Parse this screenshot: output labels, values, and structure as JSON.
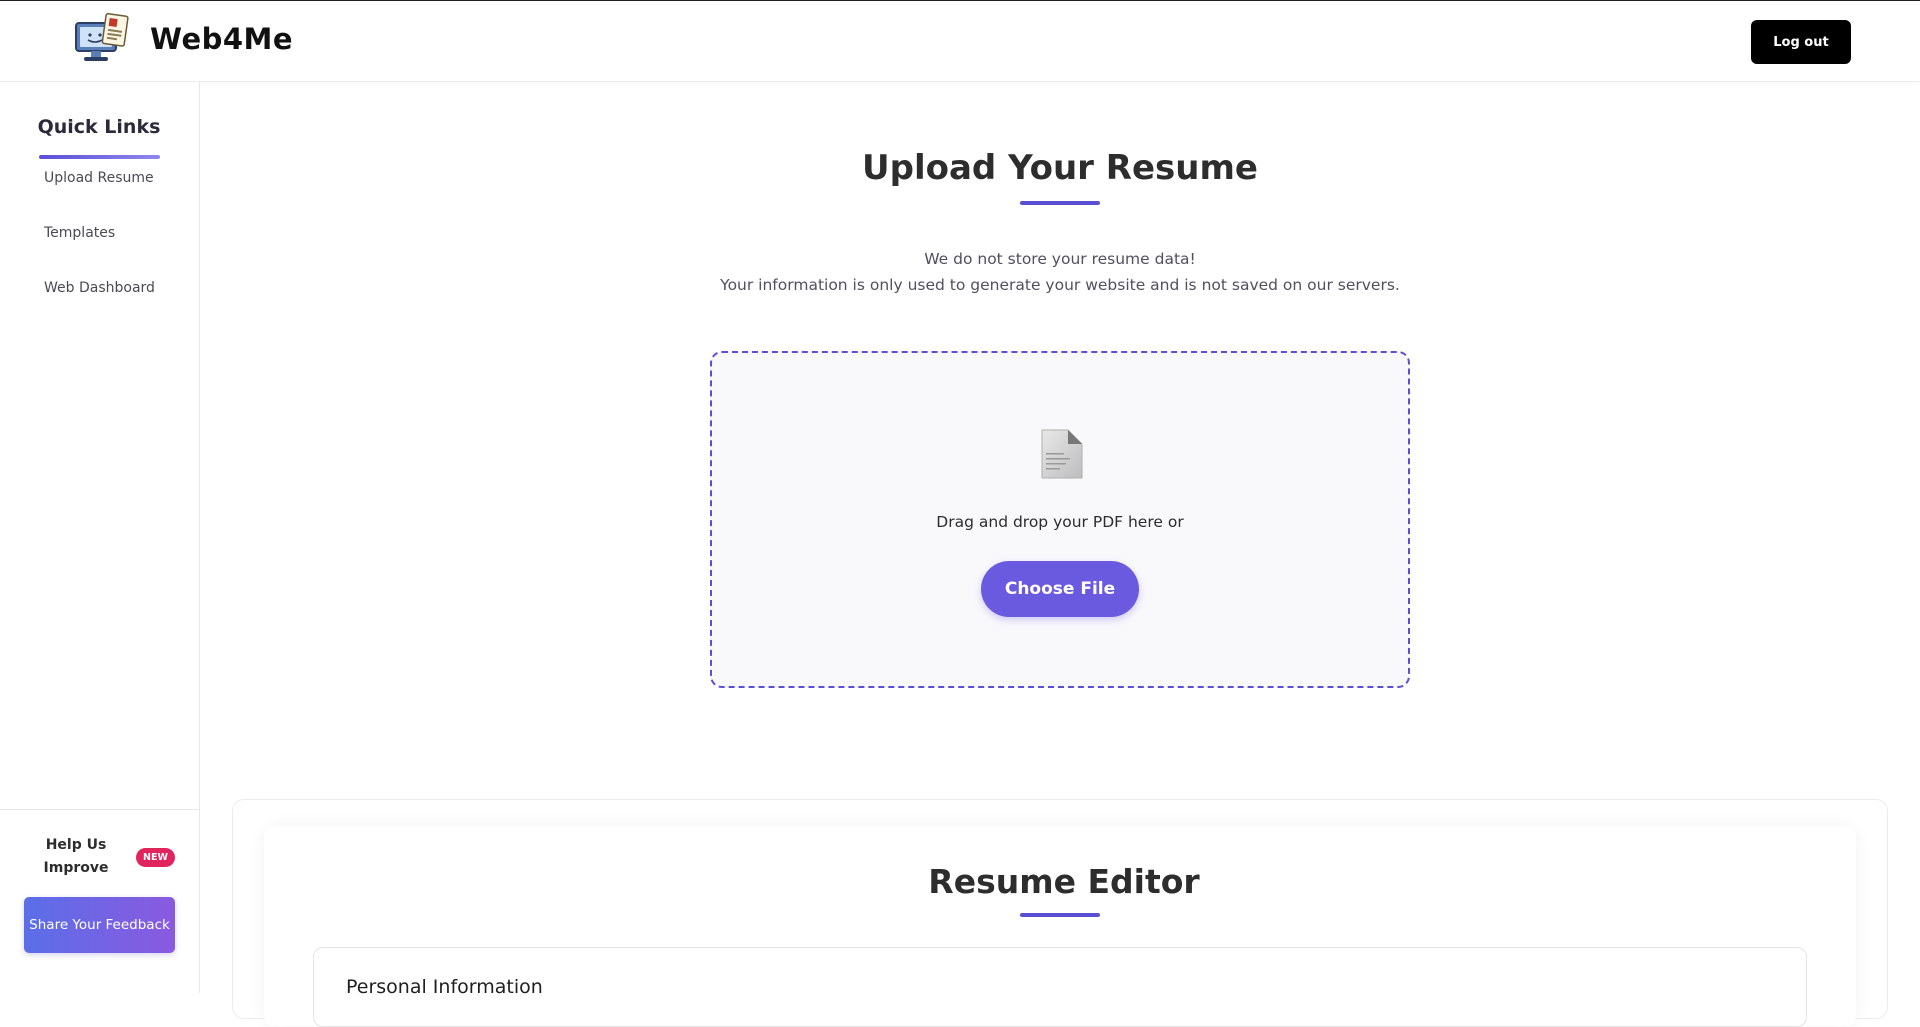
{
  "header": {
    "brand_name": "Web4Me",
    "logout_label": "Log out"
  },
  "sidebar": {
    "title": "Quick Links",
    "items": [
      {
        "label": "Upload Resume"
      },
      {
        "label": "Templates"
      },
      {
        "label": "Web Dashboard"
      }
    ],
    "help_text": "Help Us Improve",
    "new_badge": "NEW",
    "feedback_label": "Share Your Feedback"
  },
  "upload": {
    "title": "Upload Your Resume",
    "notice_line1": "We do not store your resume data!",
    "notice_line2": "Your information is only used to generate your website and is not saved on our servers.",
    "drop_text": "Drag and drop your PDF here or",
    "choose_label": "Choose File"
  },
  "editor": {
    "title": "Resume Editor",
    "section_title": "Personal Information"
  },
  "colors": {
    "accent": "#5b4fd6",
    "button_primary": "#6a5ae0",
    "badge": "#e0245e",
    "logout": "#000000"
  }
}
